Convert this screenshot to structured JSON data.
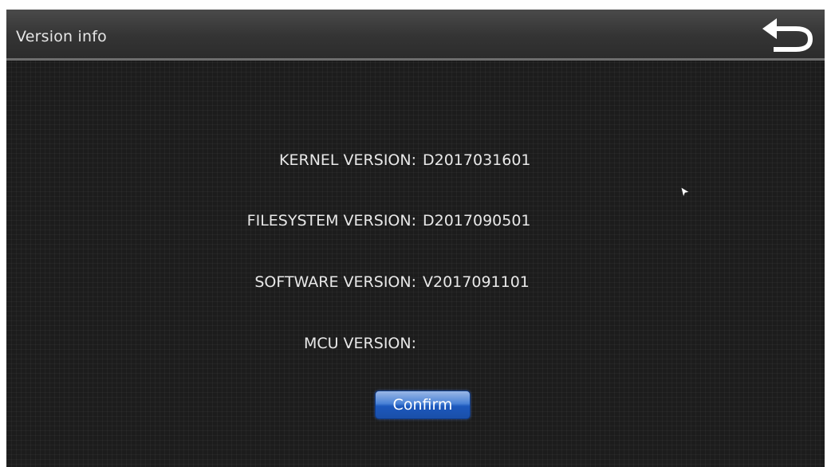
{
  "header": {
    "title": "Version info",
    "back_icon": "back-arrow-icon"
  },
  "versions": [
    {
      "label": "KERNEL VERSION:",
      "value": "D2017031601"
    },
    {
      "label": "FILESYSTEM VERSION:",
      "value": "D2017090501"
    },
    {
      "label": "SOFTWARE VERSION:",
      "value": "V2017091101"
    },
    {
      "label": "MCU VERSION:",
      "value": ""
    }
  ],
  "actions": {
    "confirm_label": "Confirm"
  },
  "colors": {
    "background": "#1c1c1c",
    "title_bar": "#3a3a3a",
    "text": "#e8e8e8",
    "confirm_button": "#2a66c8"
  }
}
